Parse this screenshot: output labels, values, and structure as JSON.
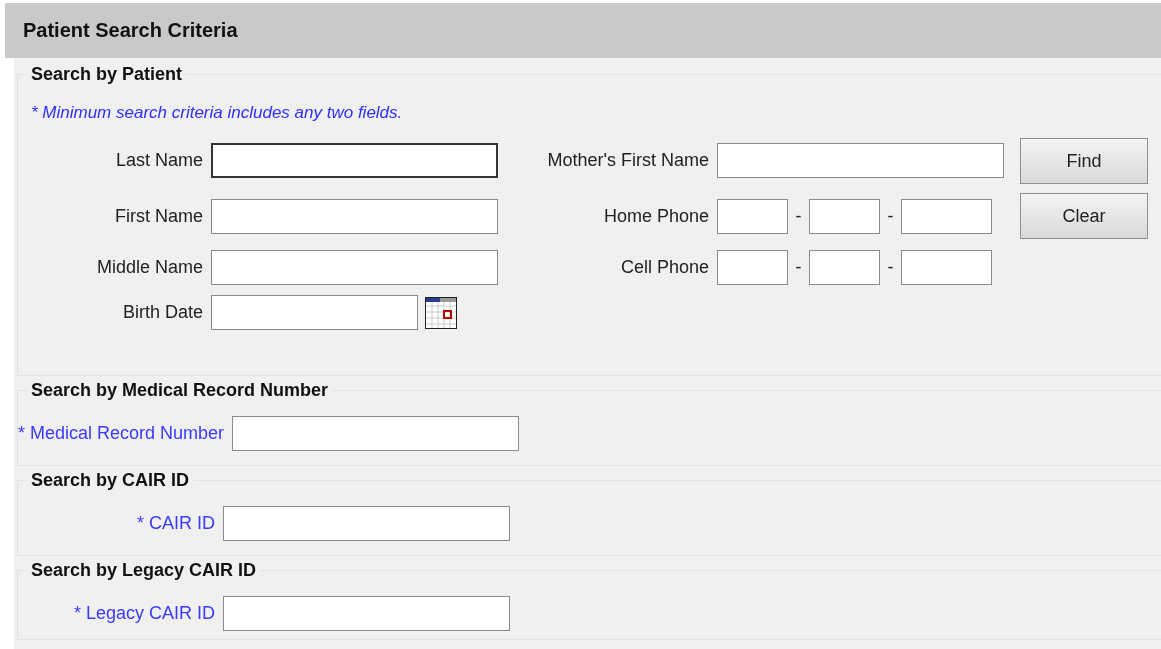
{
  "header": {
    "title": "Patient Search Criteria"
  },
  "sections": [
    {
      "kind": "patient",
      "legend": "Search by Patient",
      "note": "* Minimum search criteria includes any two fields.",
      "rows": [
        {
          "left": {
            "label": "Last Name",
            "kind": "text",
            "focused": true
          },
          "right": {
            "label": "Mother's First Name",
            "kind": "text",
            "focused": false
          }
        },
        {
          "left": {
            "label": "First Name",
            "kind": "text",
            "focused": false
          },
          "right": {
            "label": "Home Phone",
            "kind": "phone",
            "separator": "-",
            "focused": false
          }
        },
        {
          "left": {
            "label": "Middle Name",
            "kind": "text",
            "focused": false
          },
          "right": {
            "label": "Cell Phone",
            "kind": "phone",
            "separator": "-",
            "focused": false
          }
        },
        {
          "left": {
            "label": "Birth Date",
            "kind": "date",
            "focused": false
          }
        }
      ],
      "buttons": [
        {
          "label": "Find"
        },
        {
          "label": "Clear"
        }
      ]
    },
    {
      "kind": "single",
      "legend": "Search by Medical Record Number",
      "field": {
        "label": "* Medical Record Number",
        "focused": false
      }
    },
    {
      "kind": "single",
      "legend": "Search by CAIR ID",
      "field": {
        "label": "* CAIR ID",
        "focused": false
      }
    },
    {
      "kind": "single",
      "legend": "Search by Legacy CAIR ID",
      "field": {
        "label": "* Legacy CAIR ID",
        "focused": false
      }
    }
  ]
}
